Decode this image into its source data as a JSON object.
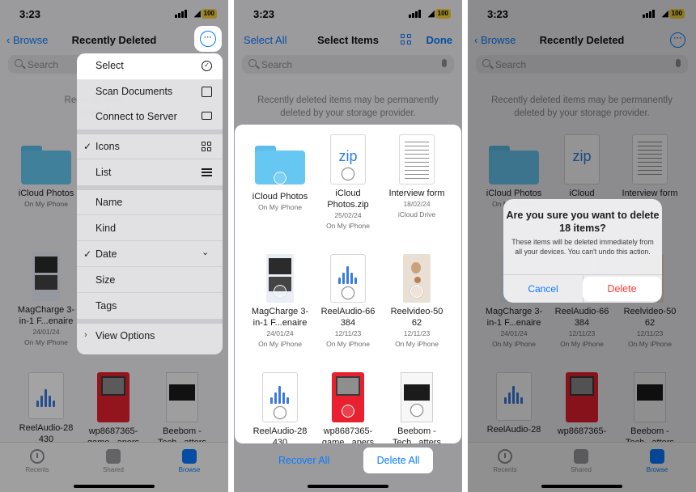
{
  "status": {
    "time": "3:23",
    "battery": "100"
  },
  "panel1": {
    "back_label": "Browse",
    "title": "Recently Deleted",
    "search_placeholder": "Search",
    "notice": [
      "Recently delet",
      "deleted"
    ],
    "files": [
      {
        "name": "iCloud Photos",
        "meta": [
          "On My iPhone"
        ]
      },
      {
        "name": "MagCharge 3-in-1 F...enaire",
        "name_lines": [
          "MagCharge 3-",
          "in-1 F...enaire"
        ],
        "meta": [
          "24/01/24",
          "On My iPhone"
        ]
      },
      {
        "name_lines": [
          "ReelAudio-28",
          "430"
        ],
        "meta": []
      },
      {
        "name_lines": [
          "wp8687365-",
          "game...apers"
        ],
        "meta": []
      },
      {
        "name_lines": [
          "Beebom -",
          "Tech...atters"
        ],
        "meta": []
      }
    ],
    "menu": {
      "items": [
        {
          "label": "Select",
          "icon": "checkmark-circle-icon"
        },
        {
          "label": "Scan Documents",
          "icon": "scan-icon"
        },
        {
          "label": "Connect to Server",
          "icon": "monitor-icon"
        },
        {
          "label": "Icons",
          "icon": "grid-icon",
          "checked": true
        },
        {
          "label": "List",
          "icon": "list-icon"
        },
        {
          "label": "Name"
        },
        {
          "label": "Kind"
        },
        {
          "label": "Date",
          "checked": true,
          "icon": "chevron-down-icon"
        },
        {
          "label": "Size"
        },
        {
          "label": "Tags"
        },
        {
          "label": "View Options",
          "icon": "chevron-right-icon"
        }
      ]
    },
    "tabs": [
      {
        "label": "Recents"
      },
      {
        "label": "Shared"
      },
      {
        "label": "Browse",
        "active": true
      }
    ]
  },
  "panel2": {
    "select_all": "Select All",
    "title": "Select Items",
    "done": "Done",
    "search_placeholder": "Search",
    "notice": [
      "Recently deleted items may be permanently",
      "deleted by your storage provider."
    ],
    "files": [
      {
        "name_lines": [
          "iCloud Photos"
        ],
        "meta": [
          "On My iPhone"
        ]
      },
      {
        "name_lines": [
          "iCloud",
          "Photos.zip"
        ],
        "meta": [
          "25/02/24",
          "On My iPhone"
        ]
      },
      {
        "name_lines": [
          "Interview form"
        ],
        "meta": [
          "18/02/24",
          "iCloud Drive"
        ]
      },
      {
        "name_lines": [
          "MagCharge 3-",
          "in-1 F...enaire"
        ],
        "meta": [
          "24/01/24",
          "On My iPhone"
        ]
      },
      {
        "name_lines": [
          "ReelAudio-66",
          "384"
        ],
        "meta": [
          "12/11/23",
          "On My iPhone"
        ]
      },
      {
        "name_lines": [
          "Reelvideo-50",
          "62"
        ],
        "meta": [
          "12/11/23",
          "On My iPhone"
        ]
      },
      {
        "name_lines": [
          "ReelAudio-28",
          "430"
        ],
        "meta": []
      },
      {
        "name_lines": [
          "wp8687365-",
          "game...apers"
        ],
        "meta": []
      },
      {
        "name_lines": [
          "Beebom -",
          "Tech...atters"
        ],
        "meta": []
      }
    ],
    "zip_text": "zip",
    "recover_all": "Recover All",
    "delete_all": "Delete All"
  },
  "panel3": {
    "back_label": "Browse",
    "title": "Recently Deleted",
    "search_placeholder": "Search",
    "notice": [
      "Recently deleted items may be permanently",
      "deleted by your storage provider."
    ],
    "files": [
      {
        "name_lines": [
          "iCloud Photos"
        ],
        "meta": [
          "On My iPhone"
        ]
      },
      {
        "name_lines": [
          "iCloud"
        ],
        "meta": []
      },
      {
        "name_lines": [
          "Interview form"
        ],
        "meta": []
      },
      {
        "name_lines": [
          "MagCharge 3-",
          "in-1 F...enaire"
        ],
        "meta": [
          "24/01/24",
          "On My iPhone"
        ]
      },
      {
        "name_lines": [
          "ReelAudio-66",
          "384"
        ],
        "meta": [
          "12/11/23",
          "On My iPhone"
        ]
      },
      {
        "name_lines": [
          "Reelvideo-50",
          "62"
        ],
        "meta": [
          "12/11/23",
          "On My iPhone"
        ]
      },
      {
        "name_lines": [
          "ReelAudio-28"
        ],
        "meta": []
      },
      {
        "name_lines": [
          "wp8687365-"
        ],
        "meta": []
      },
      {
        "name_lines": [
          "Beebom -",
          "Tech...atters"
        ],
        "meta": []
      }
    ],
    "zip_text": "zip",
    "alert": {
      "title": "Are you sure you want to delete 18 items?",
      "message": "These items will be deleted immediately from all your devices. You can't undo this action.",
      "cancel": "Cancel",
      "delete": "Delete"
    },
    "tabs": [
      {
        "label": "Recents"
      },
      {
        "label": "Shared"
      },
      {
        "label": "Browse",
        "active": true
      }
    ]
  },
  "colors": {
    "accent": "#0a7aff",
    "destructive": "#ff3b30",
    "folder": "#66c8f2",
    "battery": "#f4d13d"
  }
}
